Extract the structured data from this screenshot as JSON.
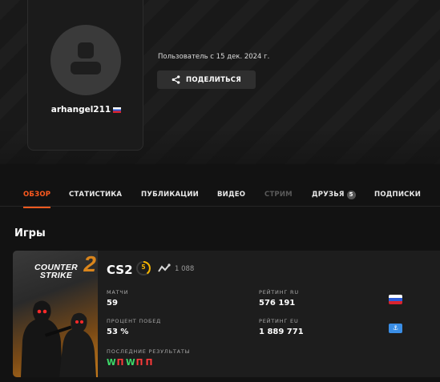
{
  "profile": {
    "username": "arhangel211",
    "member_since": "Пользователь с 15 дек. 2024 г.",
    "share_label": "ПОДЕЛИТЬСЯ"
  },
  "tabs": [
    {
      "label": "ОБЗОР",
      "state": "active"
    },
    {
      "label": "СТАТИСТИКА",
      "state": "normal"
    },
    {
      "label": "ПУБЛИКАЦИИ",
      "state": "normal"
    },
    {
      "label": "ВИДЕО",
      "state": "normal"
    },
    {
      "label": "СТРИМ",
      "state": "disabled"
    },
    {
      "label": "ДРУЗЬЯ",
      "state": "normal",
      "badge": "5"
    },
    {
      "label": "ПОДПИСКИ",
      "state": "normal"
    }
  ],
  "games_section": {
    "title": "Игры",
    "game": {
      "cover_line1": "COUNTER",
      "cover_line2": "STRIKE",
      "cover_number": "2",
      "name": "CS2",
      "level": "5",
      "elo": "1 088",
      "matches_label": "МАТЧИ",
      "matches_value": "59",
      "winrate_label": "ПРОЦЕНТ ПОБЕД",
      "winrate_value": "53 %",
      "rating_ru_label": "РЕЙТИНГ RU",
      "rating_ru_value": "576 191",
      "rating_eu_label": "РЕЙТИНГ EU",
      "rating_eu_value": "1 889 771",
      "recent_label": "ПОСЛЕДНИЕ РЕЗУЛЬТАТЫ",
      "recent_results": [
        "W",
        "П",
        "W",
        "П",
        "П"
      ]
    }
  },
  "colors": {
    "accent": "#ff5a1f",
    "win": "#3ddc6a",
    "loss": "#ff3b3b",
    "level_ring": "#f5b400"
  }
}
